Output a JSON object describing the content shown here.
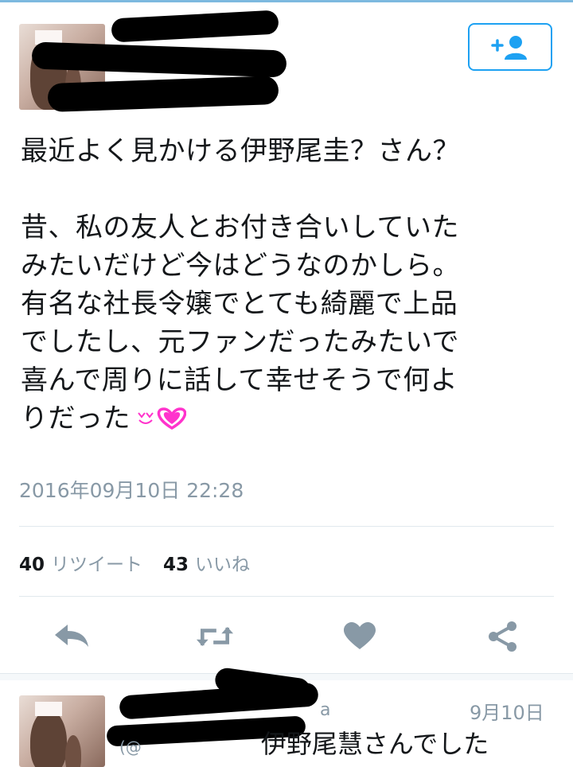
{
  "tweet": {
    "text": "最近よく見かける伊野尾圭？さん？\n\n昔、私の友人とお付き合いしていた\nみたいだけど今はどうなのかしら。\n有名な社長令嬢でとても綺麗で上品\nでしたし、元ファンだったみたいで\n喜んで周りに話して幸せそうで何よ\nりだった",
    "emoji_icon": "heart-emoji",
    "timestamp": "2016年09月10日 22:28",
    "retweet_count": "40",
    "retweet_label": "リツイート",
    "like_count": "43",
    "like_label": "いいね"
  },
  "actions": [
    {
      "icon": "reply-icon"
    },
    {
      "icon": "retweet-icon"
    },
    {
      "icon": "like-icon"
    },
    {
      "icon": "share-icon"
    }
  ],
  "reply": {
    "name_fragment": "a",
    "date": "9月10日",
    "text_prefix": "(@",
    "text": "伊野尾慧さんでした"
  },
  "colors": {
    "accent": "#1da1f2",
    "icon_gray": "#8899a6",
    "emoji_magenta": "#ff33cc"
  }
}
